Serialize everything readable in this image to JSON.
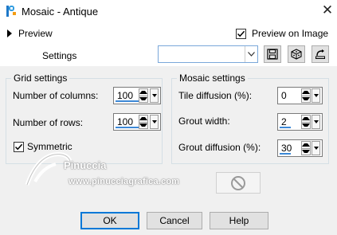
{
  "window": {
    "title": "Mosaic - Antique",
    "close_glyph": "✕"
  },
  "preview": {
    "label": "Preview"
  },
  "preview_on_image": {
    "label": "Preview on Image",
    "checked": true
  },
  "settings": {
    "label": "Settings",
    "preset_value": ""
  },
  "toolbar_icons": [
    "save-preset-icon",
    "random-dice-icon",
    "reset-icon"
  ],
  "grid_settings": {
    "legend": "Grid settings",
    "columns": {
      "label": "Number of columns:",
      "value": "100"
    },
    "rows": {
      "label": "Number of rows:",
      "value": "100"
    },
    "symmetric": {
      "label": "Symmetric",
      "checked": true
    }
  },
  "mosaic_settings": {
    "legend": "Mosaic settings",
    "tile_diffusion": {
      "label": "Tile diffusion (%):",
      "value": "0"
    },
    "grout_width": {
      "label": "Grout width:",
      "value": "2"
    },
    "grout_diffusion": {
      "label": "Grout diffusion (%):",
      "value": "30"
    }
  },
  "watermark": {
    "name": "Pinuccia",
    "site": "www.pinucciagrafica.com"
  },
  "buttons": {
    "ok": "OK",
    "cancel": "Cancel",
    "help": "Help"
  }
}
